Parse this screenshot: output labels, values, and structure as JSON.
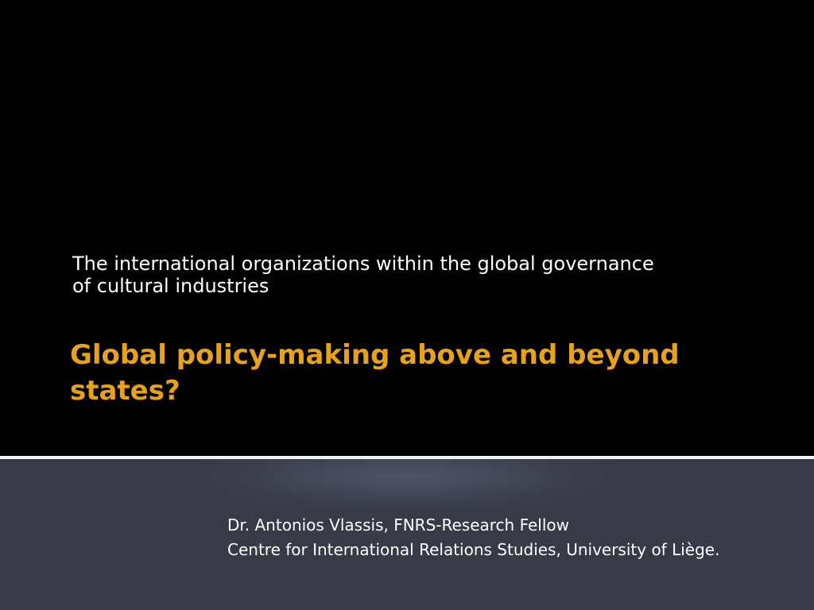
{
  "slide": {
    "subtitle_line1": "The international organizations within the global governance",
    "subtitle_line2": "of cultural industries",
    "title_line1": "Global policy-making above and beyond",
    "title_line2": "states?",
    "author": "Dr. Antonios Vlassis, FNRS-Research Fellow",
    "affiliation": "Centre for International Relations Studies, University of Liège."
  },
  "colors": {
    "background": "#000000",
    "title": "#e8a21a",
    "text": "#ffffff",
    "footer_panel": "#3a3f4b",
    "divider": "#f2f2f2"
  }
}
